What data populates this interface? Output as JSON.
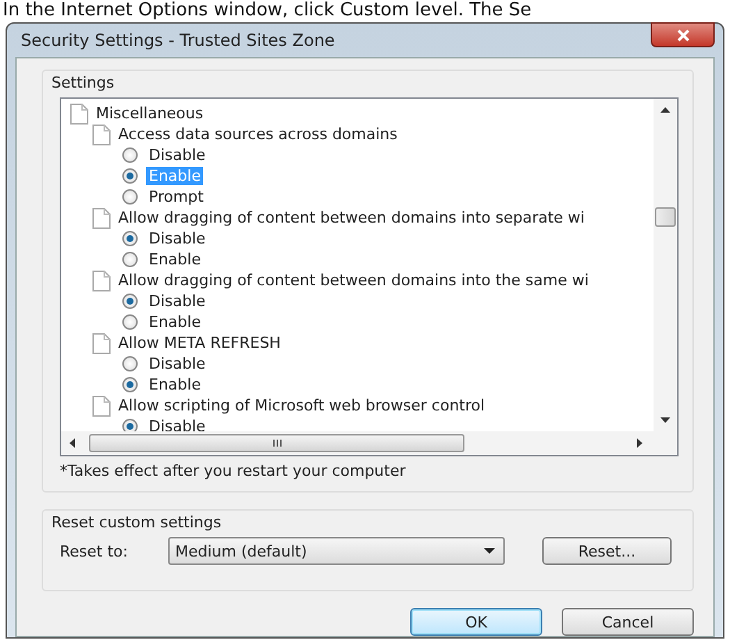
{
  "caption": "In the Internet Options window, click Custom level. The Se",
  "window": {
    "title": "Security Settings - Trusted Sites Zone"
  },
  "settings_group": {
    "label": "Settings",
    "tree": [
      {
        "label": "Miscellaneous",
        "children": [
          {
            "label": "Access data sources across domains",
            "options": [
              {
                "label": "Disable",
                "selected": false,
                "focused": false
              },
              {
                "label": "Enable",
                "selected": true,
                "focused": true
              },
              {
                "label": "Prompt",
                "selected": false,
                "focused": false
              }
            ]
          },
          {
            "label": "Allow dragging of content between domains into separate wi",
            "options": [
              {
                "label": "Disable",
                "selected": true,
                "focused": false
              },
              {
                "label": "Enable",
                "selected": false,
                "focused": false
              }
            ]
          },
          {
            "label": "Allow dragging of content between domains into the same wi",
            "options": [
              {
                "label": "Disable",
                "selected": true,
                "focused": false
              },
              {
                "label": "Enable",
                "selected": false,
                "focused": false
              }
            ]
          },
          {
            "label": "Allow META REFRESH",
            "options": [
              {
                "label": "Disable",
                "selected": false,
                "focused": false
              },
              {
                "label": "Enable",
                "selected": true,
                "focused": false
              }
            ]
          },
          {
            "label": "Allow scripting of Microsoft web browser control",
            "options": [
              {
                "label": "Disable",
                "selected": true,
                "focused": false
              }
            ]
          }
        ]
      }
    ],
    "footnote": "*Takes effect after you restart your computer"
  },
  "reset_group": {
    "label": "Reset custom settings",
    "reset_to_label": "Reset to:",
    "dropdown": {
      "value": "Medium (default)"
    },
    "reset_button": "Reset..."
  },
  "buttons": [
    {
      "label": "OK",
      "default": true
    },
    {
      "label": "Cancel",
      "default": false
    }
  ]
}
